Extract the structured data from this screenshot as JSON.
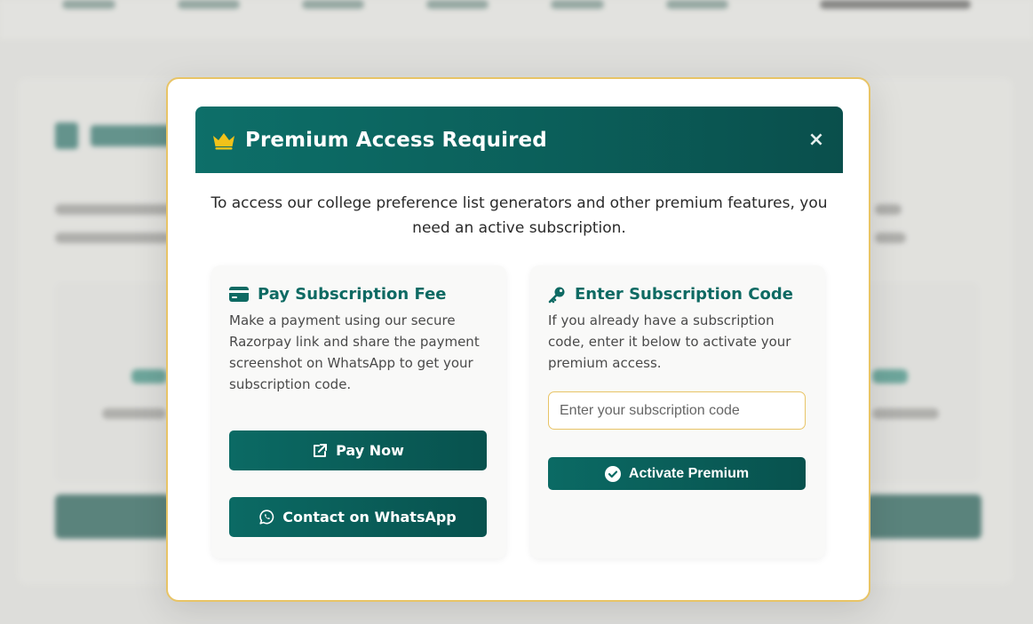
{
  "modal": {
    "title": "Premium Access Required",
    "close_symbol": "×",
    "description": "To access our college preference list generators and other premium features, you need an active subscription."
  },
  "pay_card": {
    "heading": "Pay Subscription Fee",
    "text": "Make a payment using our secure Razorpay link and share the payment screenshot on WhatsApp to get your subscription code.",
    "pay_button": "Pay Now",
    "whatsapp_button": "Contact on WhatsApp"
  },
  "code_card": {
    "heading": "Enter Subscription Code",
    "text": "If you already have a subscription code, enter it below to activate your premium access.",
    "input_value": "",
    "input_placeholder": "Enter your subscription code",
    "activate_button": "Activate Premium"
  },
  "icons": {
    "crown": "crown-icon",
    "card": "credit-card-icon",
    "key": "key-icon",
    "external": "external-link-icon",
    "whatsapp": "whatsapp-icon",
    "check": "check-circle-icon",
    "close": "close-icon"
  },
  "colors": {
    "primary": "#0b6a64",
    "primary_dark": "#0a4f4c",
    "accent_gold": "#e8c466",
    "crown": "#f2c21a"
  }
}
